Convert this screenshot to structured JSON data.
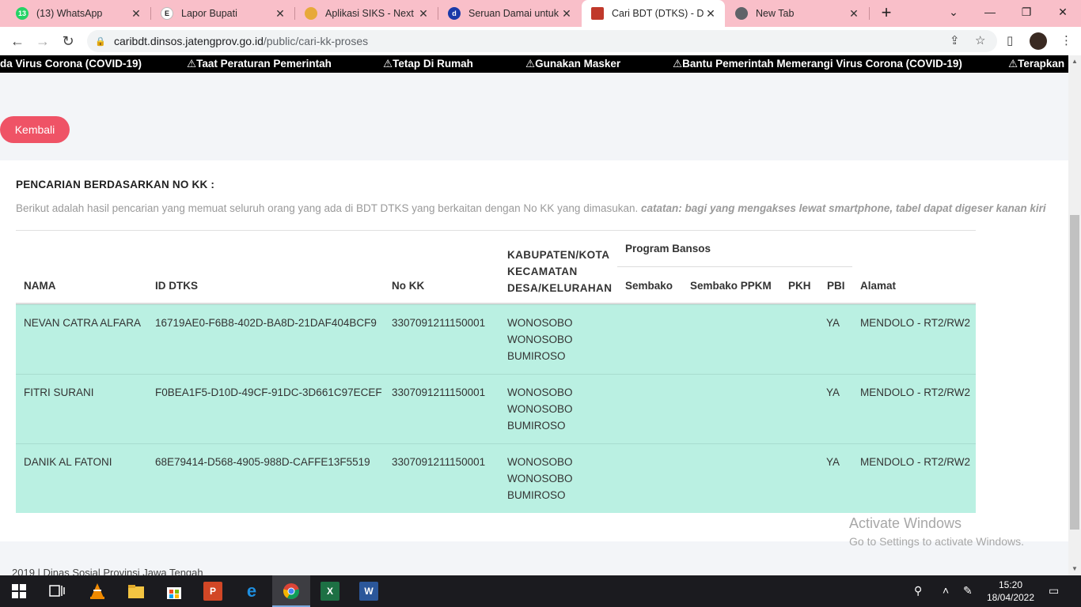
{
  "browser": {
    "tabs": [
      {
        "label": "(13) WhatsApp",
        "badge": "13",
        "icon": "whatsapp-icon",
        "color": "#25d366"
      },
      {
        "label": "Lapor Bupati",
        "badge": "",
        "icon": "lapor-icon",
        "color": "#222222"
      },
      {
        "label": "Aplikasi SIKS - Next G",
        "badge": "",
        "icon": "siks-icon",
        "color": "#e7a93a"
      },
      {
        "label": "Seruan Damai untuk D",
        "badge": "",
        "icon": "d-icon",
        "color": "#1a3aa8"
      },
      {
        "label": "Cari BDT (DTKS) - Dins",
        "badge": "",
        "icon": "dinsos-icon",
        "color": "#c0392b"
      },
      {
        "label": "New Tab",
        "badge": "",
        "icon": "chrome-icon",
        "color": "#5f6368"
      }
    ],
    "url_host": "caribdt.dinsos.jatengprov.go.id",
    "url_path": "/public/cari-kk-proses"
  },
  "marquee": [
    "da Virus Corona (COVID-19)",
    "⚠Taat Peraturan Pemerintah",
    "⚠Tetap Di Rumah",
    "⚠Gunakan Masker",
    "⚠Bantu Pemerintah Memerangi Virus Corona (COVID-19)",
    "⚠Terapkan"
  ],
  "page": {
    "back_label": "Kembali",
    "title": "PENCARIAN BERDASARKAN NO KK :",
    "description": "Berikut adalah hasil pencarian yang memuat seluruh orang yang ada di BDT DTKS yang berkaitan dengan No KK yang dimasukan.",
    "note": "catatan: bagi yang mengakses lewat smartphone, tabel dapat digeser kanan kiri",
    "table": {
      "headers": {
        "nama": "NAMA",
        "id_dtks": "ID DTKS",
        "no_kk": "No KK",
        "wilayah": [
          "KABUPATEN/KOTA",
          "KECAMATAN",
          "DESA/KELURAHAN"
        ],
        "program_group": "Program Bansos",
        "sembako": "Sembako",
        "sembako_ppkm": "Sembako PPKM",
        "pkh": "PKH",
        "pbi": "PBI",
        "alamat": "Alamat"
      },
      "rows": [
        {
          "nama": "NEVAN CATRA ALFARA",
          "id_dtks": "16719AE0-F6B8-402D-BA8D-21DAF404BCF9",
          "no_kk": "3307091211150001",
          "kab": "WONOSOBO",
          "kec": "WONOSOBO",
          "desa": "BUMIROSO",
          "sembako": "",
          "sembako_ppkm": "",
          "pkh": "",
          "pbi": "YA",
          "alamat": "MENDOLO - RT2/RW2"
        },
        {
          "nama": "FITRI SURANI",
          "id_dtks": "F0BEA1F5-D10D-49CF-91DC-3D661C97ECEF",
          "no_kk": "3307091211150001",
          "kab": "WONOSOBO",
          "kec": "WONOSOBO",
          "desa": "BUMIROSO",
          "sembako": "",
          "sembako_ppkm": "",
          "pkh": "",
          "pbi": "YA",
          "alamat": "MENDOLO - RT2/RW2"
        },
        {
          "nama": "DANIK AL FATONI",
          "id_dtks": "68E79414-D568-4905-988D-CAFFE13F5519",
          "no_kk": "3307091211150001",
          "kab": "WONOSOBO",
          "kec": "WONOSOBO",
          "desa": "BUMIROSO",
          "sembako": "",
          "sembako_ppkm": "",
          "pkh": "",
          "pbi": "YA",
          "alamat": "MENDOLO - RT2/RW2"
        }
      ]
    },
    "footer": "2019 | Dinas Sosial Provinsi Jawa Tengah"
  },
  "watermark": {
    "line1": "Activate Windows",
    "line2": "Go to Settings to activate Windows."
  },
  "taskbar": {
    "time": "15:20",
    "date": "18/04/2022"
  },
  "colors": {
    "tabstrip": "#f9bfc9",
    "back_button": "#ef5366",
    "row_highlight": "#baf0e2"
  }
}
